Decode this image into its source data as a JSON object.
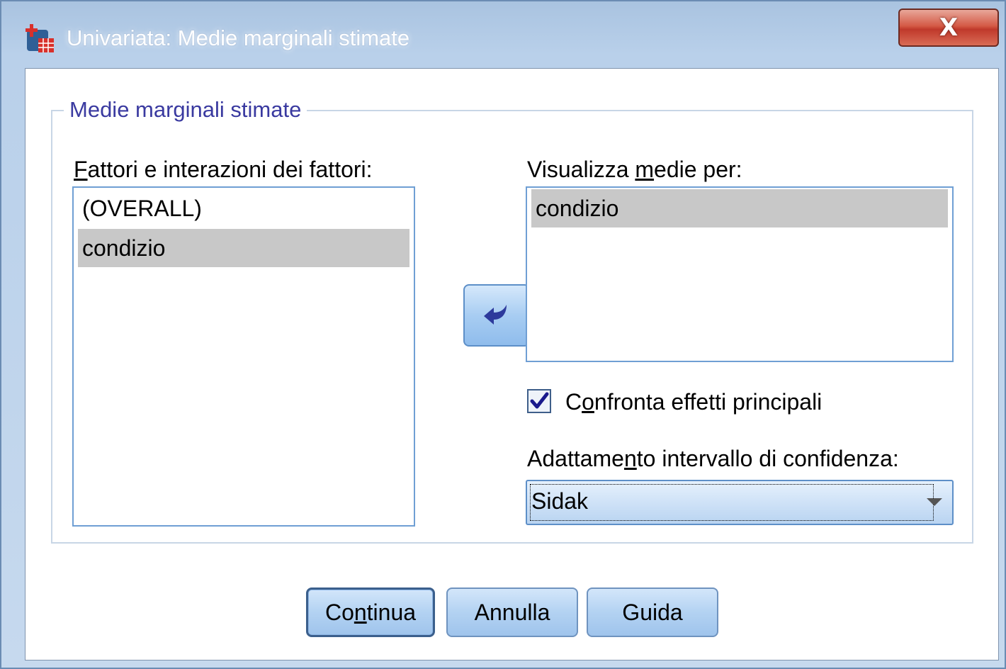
{
  "window": {
    "title": "Univariata: Medie marginali stimate",
    "close_glyph": "X",
    "app_icon": "spss-dialog-icon"
  },
  "group": {
    "legend": "Medie marginali stimate"
  },
  "factors": {
    "label_accel": "F",
    "label_rest": "attori e interazioni dei fattori:",
    "items": [
      {
        "label": "(OVERALL)",
        "selected": false
      },
      {
        "label": "condizio",
        "selected": true
      }
    ]
  },
  "display_means": {
    "label_pre": "Visualizza ",
    "label_accel": "m",
    "label_post": "edie per:",
    "items": [
      {
        "label": "condizio",
        "selected": true
      }
    ]
  },
  "move_button": {
    "icon": "arrow-left-icon"
  },
  "compare": {
    "checked": true,
    "label_pre": "C",
    "label_accel": "o",
    "label_post": "nfronta effetti principali"
  },
  "ci_adjustment": {
    "label_pre": "Adattame",
    "label_accel": "n",
    "label_post": "to intervallo di confidenza:",
    "value": "Sidak"
  },
  "buttons": {
    "continue_pre": "Co",
    "continue_accel": "n",
    "continue_post": "tinua",
    "cancel": "Annulla",
    "help": "Guida"
  },
  "colors": {
    "accent": "#5d8fc8",
    "check": "#1a1a8c",
    "legend": "#3a3aa0",
    "selection": "#c8c8c8"
  }
}
